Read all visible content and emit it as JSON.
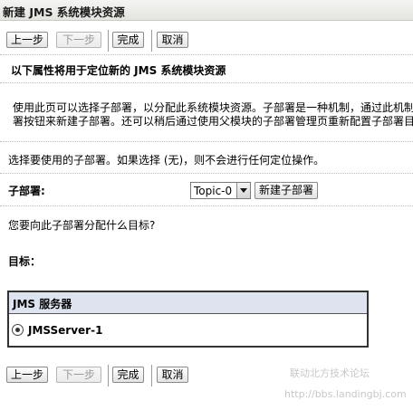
{
  "window": {
    "title": "新建 JMS 系统模块资源"
  },
  "toolbar": {
    "back_label": "上一步",
    "next_label": "下一步",
    "finish_label": "完成",
    "cancel_label": "取消"
  },
  "content": {
    "heading": "以下属性将用于定位新的 JMS 系统模块资源",
    "description_line1": "使用此页可以选择子部署，以分配此系统模块资源。子部署是一种机制，通过此机制可",
    "description_line2": "署按钮来新建子部署。还可以稍后通过使用父模块的子部署管理页重新配置子部署目",
    "select_prompt": "选择要使用的子部署。如果选择 (无)，则不会进行任何定位操作。",
    "subdeployment_label": "子部署:",
    "subdeployment_value": "Topic-0",
    "new_subdeployment_label": "新建子部署",
    "target_question": "您要向此子部署分配什么目标?",
    "targets_label": "目标："
  },
  "targets_table": {
    "header": "JMS 服务器",
    "rows": [
      {
        "label": "JMSServer-1",
        "selected": true
      }
    ]
  },
  "watermark": {
    "line1": "联动北方技术论坛",
    "line2": "http://bbs.landingbj.com"
  }
}
